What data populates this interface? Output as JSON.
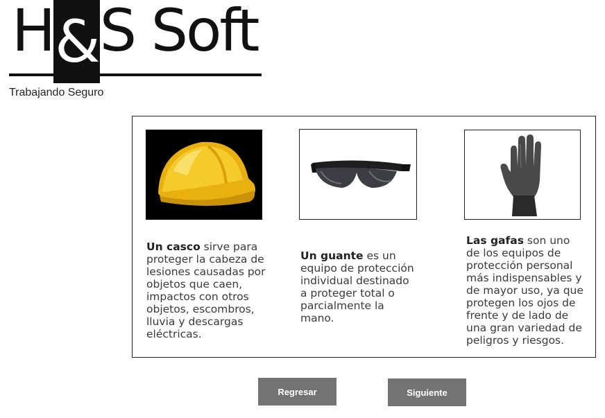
{
  "brand": {
    "name_left": "H",
    "name_amp": "&",
    "name_right": "S Soft",
    "tagline": "Trabajando Seguro"
  },
  "cards": [
    {
      "image": "hard-hat-image",
      "bold": "Un  casco",
      "text": " sirve para proteger la cabeza de lesiones causadas por objetos que caen, impactos con otros objetos, escombros, lluvia y descargas eléctricas."
    },
    {
      "image": "safety-glasses-image",
      "bold": "Un guante",
      "text": " es un equipo de protección individual destinado a proteger total o parcialmente la mano."
    },
    {
      "image": "rubber-glove-image",
      "bold": "Las gafas",
      "text": " son uno de los equipos de protección personal más indispensables y de mayor uso, ya que protegen los ojos de frente y de lado de una gran variedad de peligros y riesgos."
    }
  ],
  "buttons": {
    "back": "Regresar",
    "next": "Siguiente"
  },
  "colors": {
    "button_bg": "#737373",
    "helmet": "#f2c318",
    "text": "#3a3a3a"
  }
}
